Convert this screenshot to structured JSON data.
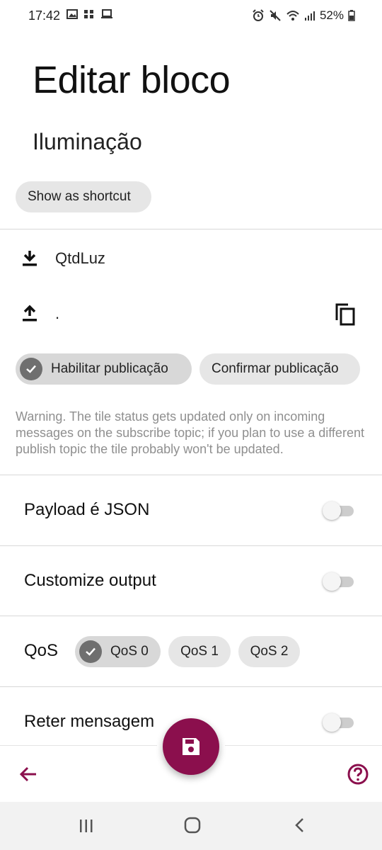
{
  "status_bar": {
    "time": "17:42",
    "battery": "52%"
  },
  "page_title": "Editar bloco",
  "section_title": "Iluminação",
  "shortcut_chip": "Show as shortcut",
  "subscribe_topic": "QtdLuz",
  "publish_topic": ".",
  "publish_chips": {
    "enable": "Habilitar publicação",
    "confirm": "Confirmar publicação"
  },
  "warning": "Warning. The tile status gets updated only on incoming messages on the subscribe topic; if you plan to use a different publish topic the tile probably won't be updated.",
  "settings": {
    "payload_json": {
      "label": "Payload é JSON",
      "enabled": false
    },
    "customize_output": {
      "label": "Customize output",
      "enabled": false
    },
    "qos": {
      "label": "QoS",
      "options": [
        "QoS 0",
        "QoS 1",
        "QoS 2"
      ],
      "selected": "QoS 0"
    },
    "retain": {
      "label": "Reter mensagem",
      "enabled": false
    }
  },
  "colors": {
    "accent": "#8b0f4d"
  },
  "icons": {
    "subscribe": "download-icon",
    "publish": "upload-icon",
    "copy": "copy-icon",
    "save": "save-icon",
    "back": "arrow-left-icon",
    "help": "help-icon"
  }
}
